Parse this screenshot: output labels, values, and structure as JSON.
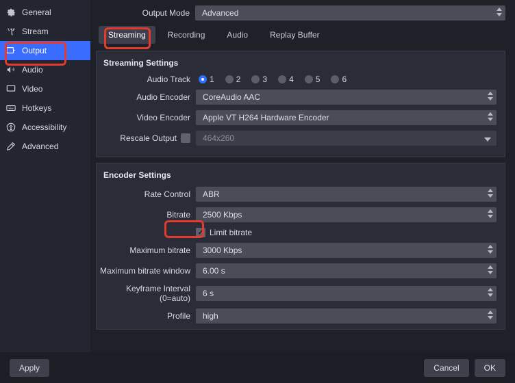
{
  "sidebar": {
    "items": [
      {
        "label": "General"
      },
      {
        "label": "Stream"
      },
      {
        "label": "Output"
      },
      {
        "label": "Audio"
      },
      {
        "label": "Video"
      },
      {
        "label": "Hotkeys"
      },
      {
        "label": "Accessibility"
      },
      {
        "label": "Advanced"
      }
    ]
  },
  "outputMode": {
    "label": "Output Mode",
    "value": "Advanced"
  },
  "tabs": [
    {
      "label": "Streaming"
    },
    {
      "label": "Recording"
    },
    {
      "label": "Audio"
    },
    {
      "label": "Replay Buffer"
    }
  ],
  "streamingPanel": {
    "title": "Streaming Settings",
    "audioTrack": {
      "label": "Audio Track",
      "options": [
        "1",
        "2",
        "3",
        "4",
        "5",
        "6"
      ],
      "selected": "1"
    },
    "audioEncoder": {
      "label": "Audio Encoder",
      "value": "CoreAudio AAC"
    },
    "videoEncoder": {
      "label": "Video Encoder",
      "value": "Apple VT H264 Hardware Encoder"
    },
    "rescale": {
      "label": "Rescale Output",
      "checked": false,
      "value": "464x260"
    }
  },
  "encoderPanel": {
    "title": "Encoder Settings",
    "rateControl": {
      "label": "Rate Control",
      "value": "ABR"
    },
    "bitrate": {
      "label": "Bitrate",
      "value": "2500 Kbps"
    },
    "limitBitrate": {
      "label": "Limit bitrate",
      "checked": true
    },
    "maxBitrate": {
      "label": "Maximum bitrate",
      "value": "3000 Kbps"
    },
    "maxBitrateWindow": {
      "label": "Maximum bitrate window",
      "value": "6.00 s"
    },
    "keyframe": {
      "label": "Keyframe Interval (0=auto)",
      "value": "6 s"
    },
    "profile": {
      "label": "Profile",
      "value": "high"
    }
  },
  "footer": {
    "apply": "Apply",
    "cancel": "Cancel",
    "ok": "OK"
  }
}
